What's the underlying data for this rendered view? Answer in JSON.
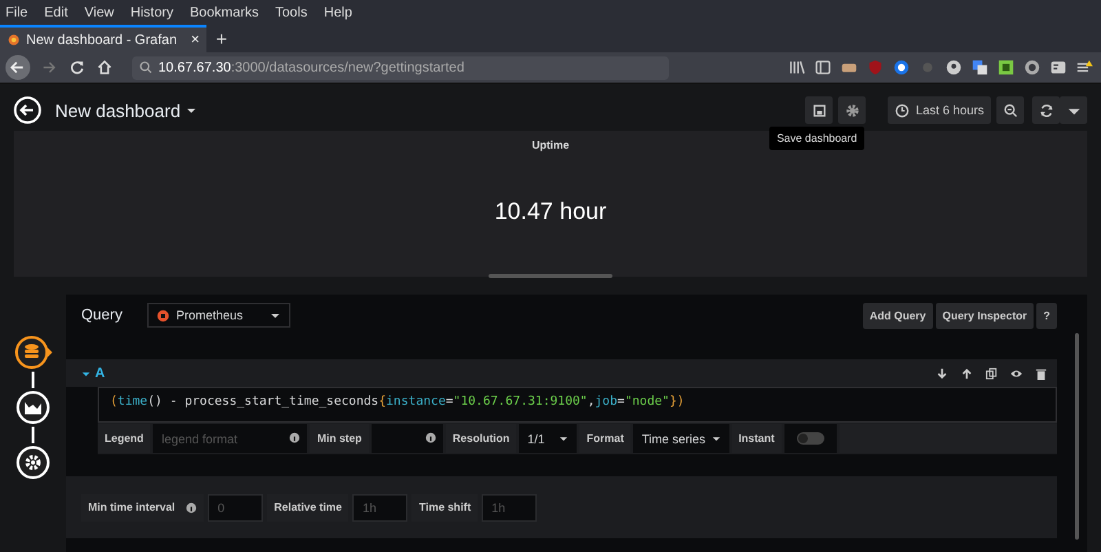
{
  "browser": {
    "menu": [
      "File",
      "Edit",
      "View",
      "History",
      "Bookmarks",
      "Tools",
      "Help"
    ],
    "tab": {
      "title": "New dashboard - Grafan",
      "close": "×"
    },
    "new_tab": "+",
    "url": {
      "host": "10.67.67.30",
      "rest": ":3000/datasources/new?gettingstarted"
    }
  },
  "dashboard": {
    "title": "New dashboard",
    "time_range": "Last 6 hours",
    "tooltip": "Save dashboard"
  },
  "panel": {
    "title": "Uptime",
    "value": "10.47 hour"
  },
  "query": {
    "label": "Query",
    "datasource": "Prometheus",
    "buttons": [
      "Add Query",
      "Query Inspector",
      "?"
    ],
    "ref": "A",
    "tokens": [
      {
        "text": "(",
        "kind": "paren"
      },
      {
        "text": "time",
        "kind": "func"
      },
      {
        "text": "() - process_start_time_seconds",
        "kind": "plain"
      },
      {
        "text": "{",
        "kind": "paren"
      },
      {
        "text": "instance",
        "kind": "func"
      },
      {
        "text": "=",
        "kind": "plain"
      },
      {
        "text": "\"10.67.67.31:9100\"",
        "kind": "string"
      },
      {
        "text": ",",
        "kind": "plain"
      },
      {
        "text": "job",
        "kind": "func"
      },
      {
        "text": "=",
        "kind": "plain"
      },
      {
        "text": "\"node\"",
        "kind": "string"
      },
      {
        "text": "})",
        "kind": "paren"
      }
    ],
    "legend_label": "Legend",
    "legend_placeholder": "legend format",
    "min_step_label": "Min step",
    "resolution_label": "Resolution",
    "resolution": "1/1",
    "format_label": "Format",
    "format": "Time series",
    "instant_label": "Instant",
    "instant": {
      "on": false
    }
  },
  "options": {
    "min_interval_label": "Min time interval",
    "min_interval_placeholder": "0",
    "relative_label": "Relative time",
    "relative_placeholder": "1h",
    "shift_label": "Time shift",
    "shift_placeholder": "1h"
  }
}
